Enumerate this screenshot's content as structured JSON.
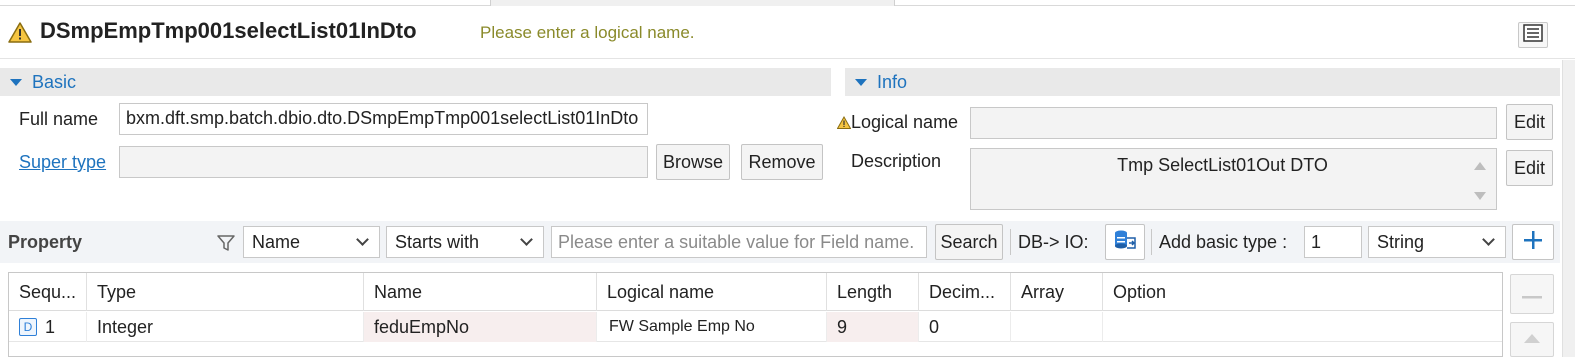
{
  "header": {
    "title": "DSmpEmpTmp001selectList01InDto",
    "message": "Please enter a logical name."
  },
  "basic": {
    "section_label": "Basic",
    "full_name_label": "Full name",
    "full_name_value": "bxm.dft.smp.batch.dbio.dto.DSmpEmpTmp001selectList01InDto",
    "super_type_label": "Super type",
    "super_type_value": "",
    "browse_label": "Browse",
    "remove_label": "Remove"
  },
  "info": {
    "section_label": "Info",
    "logical_name_label": "Logical name",
    "logical_name_value": "",
    "description_label": "Description",
    "description_value": "Tmp SelectList01Out DTO",
    "edit_label": "Edit"
  },
  "property": {
    "label": "Property",
    "filter_field": "Name",
    "filter_mode": "Starts with",
    "search_placeholder": "Please enter a suitable value for Field name.",
    "search_label": "Search",
    "db_io_label": "DB-> IO:",
    "add_basic_type_label": "Add basic type :",
    "add_count": "1",
    "basic_type": "String"
  },
  "table": {
    "columns": [
      "Sequ...",
      "Type",
      "Name",
      "Logical name",
      "Length",
      "Decim...",
      "Array",
      "Option"
    ],
    "rows": [
      {
        "seq": "1",
        "type": "Integer",
        "name": "feduEmpNo",
        "logical_name": "FW Sample Emp No",
        "length": "9",
        "decimal": "0",
        "array": "",
        "option": ""
      }
    ]
  },
  "icons": {
    "warning": "warning-triangle-icon",
    "accent": "#1e73be",
    "warning_color": "#f0b429"
  }
}
